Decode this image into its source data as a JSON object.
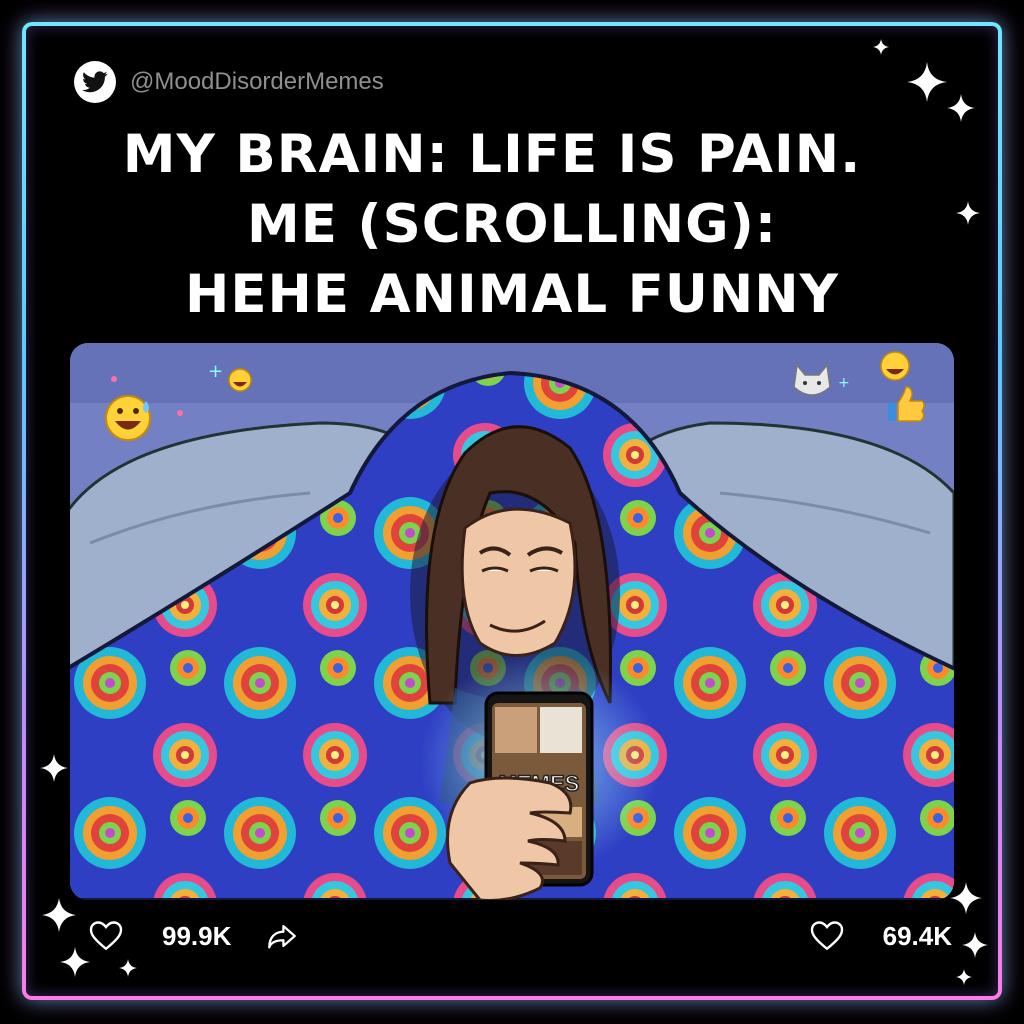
{
  "post": {
    "handle": "@MoodDisorderMemes",
    "caption_lines": [
      "MY BRAIN: LIFE IS PAIN.",
      "ME (SCROLLING):",
      "HEHE ANIMAL FUNNY"
    ],
    "phone_label": "MEMES",
    "likes_left": "99.9K",
    "likes_right": "69.4K"
  },
  "icons": {
    "platform": "bird-icon",
    "like": "heart-icon",
    "share": "share-arrow-icon"
  },
  "colors": {
    "frame_top": "#6fe7ff",
    "frame_bottom": "#ff7be8",
    "background": "#000000",
    "handle_text": "#8f8f8f",
    "caption_text": "#ffffff"
  }
}
